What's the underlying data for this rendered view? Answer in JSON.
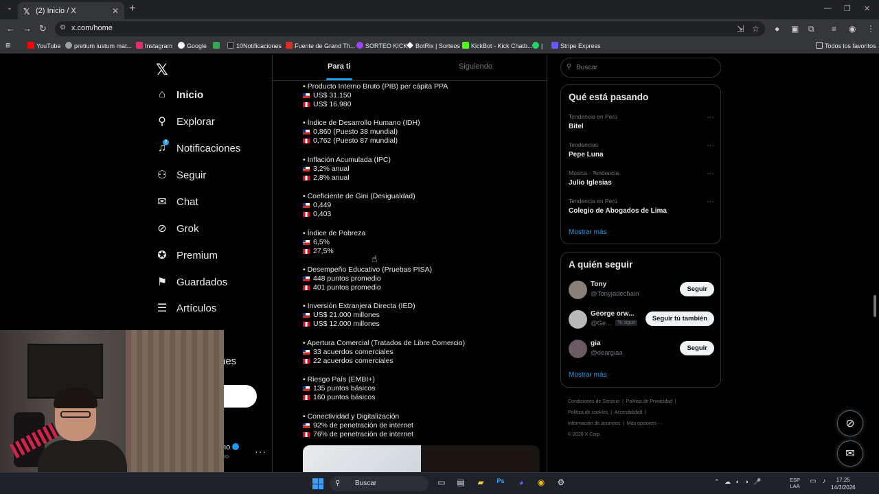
{
  "browser": {
    "tab_title": "(2) Inicio / X",
    "url": "x.com/home",
    "bookmarks": [
      {
        "label": "YouTube",
        "color": "#ff0000"
      },
      {
        "label": "pretium iustum mat...",
        "color": "#9aa0a6"
      },
      {
        "label": "Instagram",
        "color": "#e1306c"
      },
      {
        "label": "Google",
        "color": "#4285f4"
      },
      {
        "label": "",
        "color": "#34a853"
      },
      {
        "label": "10Notificaciones",
        "color": "#ffffff"
      },
      {
        "label": "Fuente de Grand Th...",
        "color": "#d93025"
      },
      {
        "label": "SORTEO KICK",
        "color": "#a142f4"
      },
      {
        "label": "BotRix | Sorteos",
        "color": "#ffffff"
      },
      {
        "label": "KickBot - Kick Chatb...",
        "color": "#53fc18"
      },
      {
        "label": "|",
        "color": "#25d366"
      },
      {
        "label": "Stripe Express",
        "color": "#635bff"
      }
    ],
    "all_bookmarks": "Todos los favoritos"
  },
  "sidebar": {
    "items": [
      {
        "label": "Inicio",
        "icon": "home-icon",
        "glyph": "⌂"
      },
      {
        "label": "Explorar",
        "icon": "search-icon",
        "glyph": "⚲"
      },
      {
        "label": "Notificaciones",
        "icon": "bell-icon",
        "glyph": "🔔",
        "badge": "2"
      },
      {
        "label": "Seguir",
        "icon": "person-add-icon",
        "glyph": "👤"
      },
      {
        "label": "Chat",
        "icon": "mail-icon",
        "glyph": "✉"
      },
      {
        "label": "Grok",
        "icon": "grok-icon",
        "glyph": "⊘"
      },
      {
        "label": "Premium",
        "icon": "verified-icon",
        "glyph": "✔"
      },
      {
        "label": "Guardados",
        "icon": "bookmark-icon",
        "glyph": "🔖"
      },
      {
        "label": "Artículos",
        "icon": "article-icon",
        "glyph": "📄"
      }
    ],
    "more_partial": "nes",
    "account_partial": "no",
    "account_handle_partial": "no",
    "account_dots": "···"
  },
  "feed": {
    "tabs": [
      "Para ti",
      "Siguiendo"
    ],
    "sections": [
      {
        "title": "• Producto Interno Bruto (PIB) per cápita PPA",
        "chile": "US$ 31.150",
        "peru": "US$ 16.980"
      },
      {
        "title": "• Índice de Desarrollo Humano (IDH)",
        "chile": "0,860 (Puesto 38 mundial)",
        "peru": "0,762 (Puesto 87 mundial)"
      },
      {
        "title": "• Inflación Acumulada (IPC)",
        "chile": "3,2% anual",
        "peru": "2,8% anual"
      },
      {
        "title": "• Coeficiente de Gini (Desigualdad)",
        "chile": "0,449",
        "peru": "0,403"
      },
      {
        "title": "• Índice de Pobreza",
        "chile": "6,5%",
        "peru": "27,5%"
      },
      {
        "title": "• Desempeño Educativo (Pruebas PISA)",
        "chile": "448 puntos promedio",
        "peru": "401 puntos promedio"
      },
      {
        "title": "• Inversión Extranjera Directa (IED)",
        "chile": "US$ 21.000 millones",
        "peru": "US$ 12.000 millones"
      },
      {
        "title": "• Apertura Comercial (Tratados de Libre Comercio)",
        "chile": "33 acuerdos comerciales",
        "peru": "22 acuerdos comerciales"
      },
      {
        "title": "• Riesgo País (EMBI+)",
        "chile": "135 puntos básicos",
        "peru": "160 puntos básicos"
      },
      {
        "title": "• Conectividad y Digitalización",
        "chile": "92% de penetración de internet",
        "peru": "76% de penetración de internet"
      }
    ]
  },
  "right": {
    "search_placeholder": "Buscar",
    "trends_title": "Qué está pasando",
    "trends": [
      {
        "context": "Tendencia en Perú",
        "topic": "Bitel"
      },
      {
        "context": "Tendencias",
        "topic": "Pepe Luna"
      },
      {
        "context": "Música · Tendencia",
        "topic": "Julio Iglesias"
      },
      {
        "context": "Tendencia en Perú",
        "topic": "Colegio de Abogados de Lima"
      }
    ],
    "show_more": "Mostrar más",
    "follow_title": "A quién seguir",
    "follow": [
      {
        "name": "Tony",
        "handle": "@Tonyjadechain",
        "button": "Seguir",
        "color": "#8a7f78"
      },
      {
        "name": "George orw...",
        "handle": "@Ge...",
        "follows_you": "Te sigue",
        "button": "Seguir tú también",
        "color": "#b9b9b9"
      },
      {
        "name": "gia",
        "handle": "@deargiaa",
        "button": "Seguir",
        "color": "#6b5a63"
      }
    ],
    "footer": [
      "Condiciones de Servicio",
      "Política de Privacidad",
      "Política de cookies",
      "Accesibilidad",
      "Información de anuncios",
      "Más opciones ···",
      "© 2026 X Corp."
    ]
  },
  "taskbar": {
    "search": "Buscar",
    "lang": "ESP",
    "lang2": "LAA",
    "time": "17:25",
    "date": "14/3/2026"
  }
}
